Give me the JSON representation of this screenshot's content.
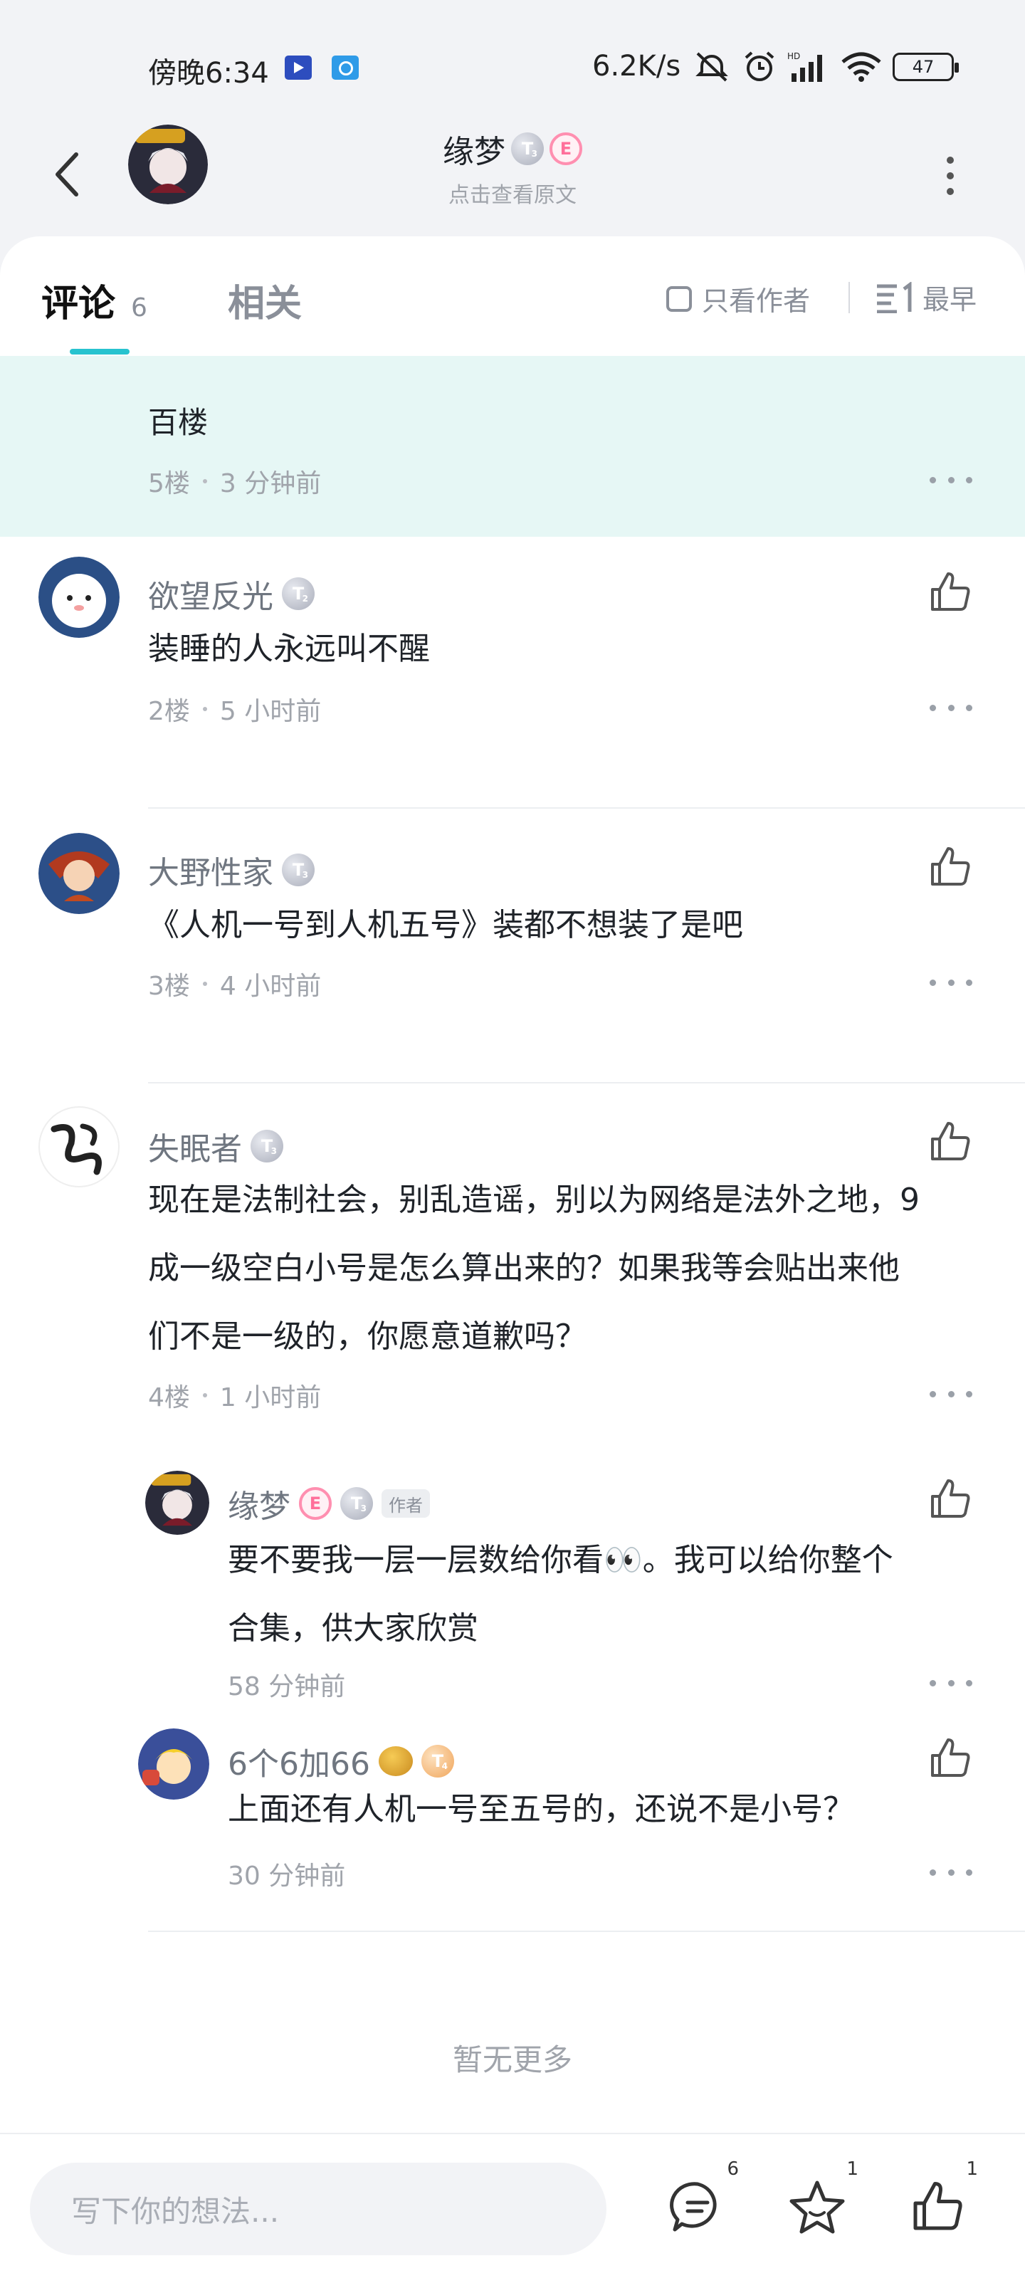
{
  "status_bar": {
    "time": "傍晚6:34",
    "speed": "6.2K/s",
    "battery": "47"
  },
  "header": {
    "name": "缘梦",
    "subtitle": "点击查看原文",
    "level_badge": "T",
    "pink_badge": "E"
  },
  "tabs": {
    "comments_label": "评论",
    "comments_count": "6",
    "related_label": "相关",
    "only_author_label": "只看作者",
    "sort_label": "最早"
  },
  "highlight": {
    "body": "百楼",
    "floor": "5楼",
    "time": "3 分钟前"
  },
  "comments": [
    {
      "name": "欲望反光",
      "body": "装睡的人永远叫不醒",
      "floor": "2楼",
      "time": "5 小时前",
      "level": "T"
    },
    {
      "name": "大野性家",
      "body": "《人机一号到人机五号》装都不想装了是吧",
      "floor": "3楼",
      "time": "4 小时前",
      "level": "T"
    },
    {
      "name": "失眠者",
      "body_line1": "现在是法制社会，别乱造谣，别以为网络是法外之地，9",
      "body_line2": "成一级空白小号是怎么算出来的？如果我等会贴出来他",
      "body_line3": "们不是一级的，你愿意道歉吗？",
      "floor": "4楼",
      "time": "1 小时前",
      "level": "T"
    }
  ],
  "replies": [
    {
      "name": "缘梦",
      "author_tag": "作者",
      "body_line1": "要不要我一层一层数给你看👀。我可以给你整个",
      "body_line2": "合集，供大家欣赏",
      "time": "58 分钟前",
      "pink": "E",
      "level": "T"
    },
    {
      "name": "6个6加66",
      "body": "上面还有人机一号至五号的，还说不是小号？",
      "time": "30 分钟前",
      "level": "T"
    }
  ],
  "no_more": "暂无更多",
  "bottom": {
    "input_placeholder": "写下你的想法...",
    "comment_count": "6",
    "star_count": "1",
    "like_count": "1"
  },
  "colors": {
    "accent": "#27c3cf",
    "highlight_bg": "#e6f7f5",
    "muted_text": "#a0a4ab"
  }
}
